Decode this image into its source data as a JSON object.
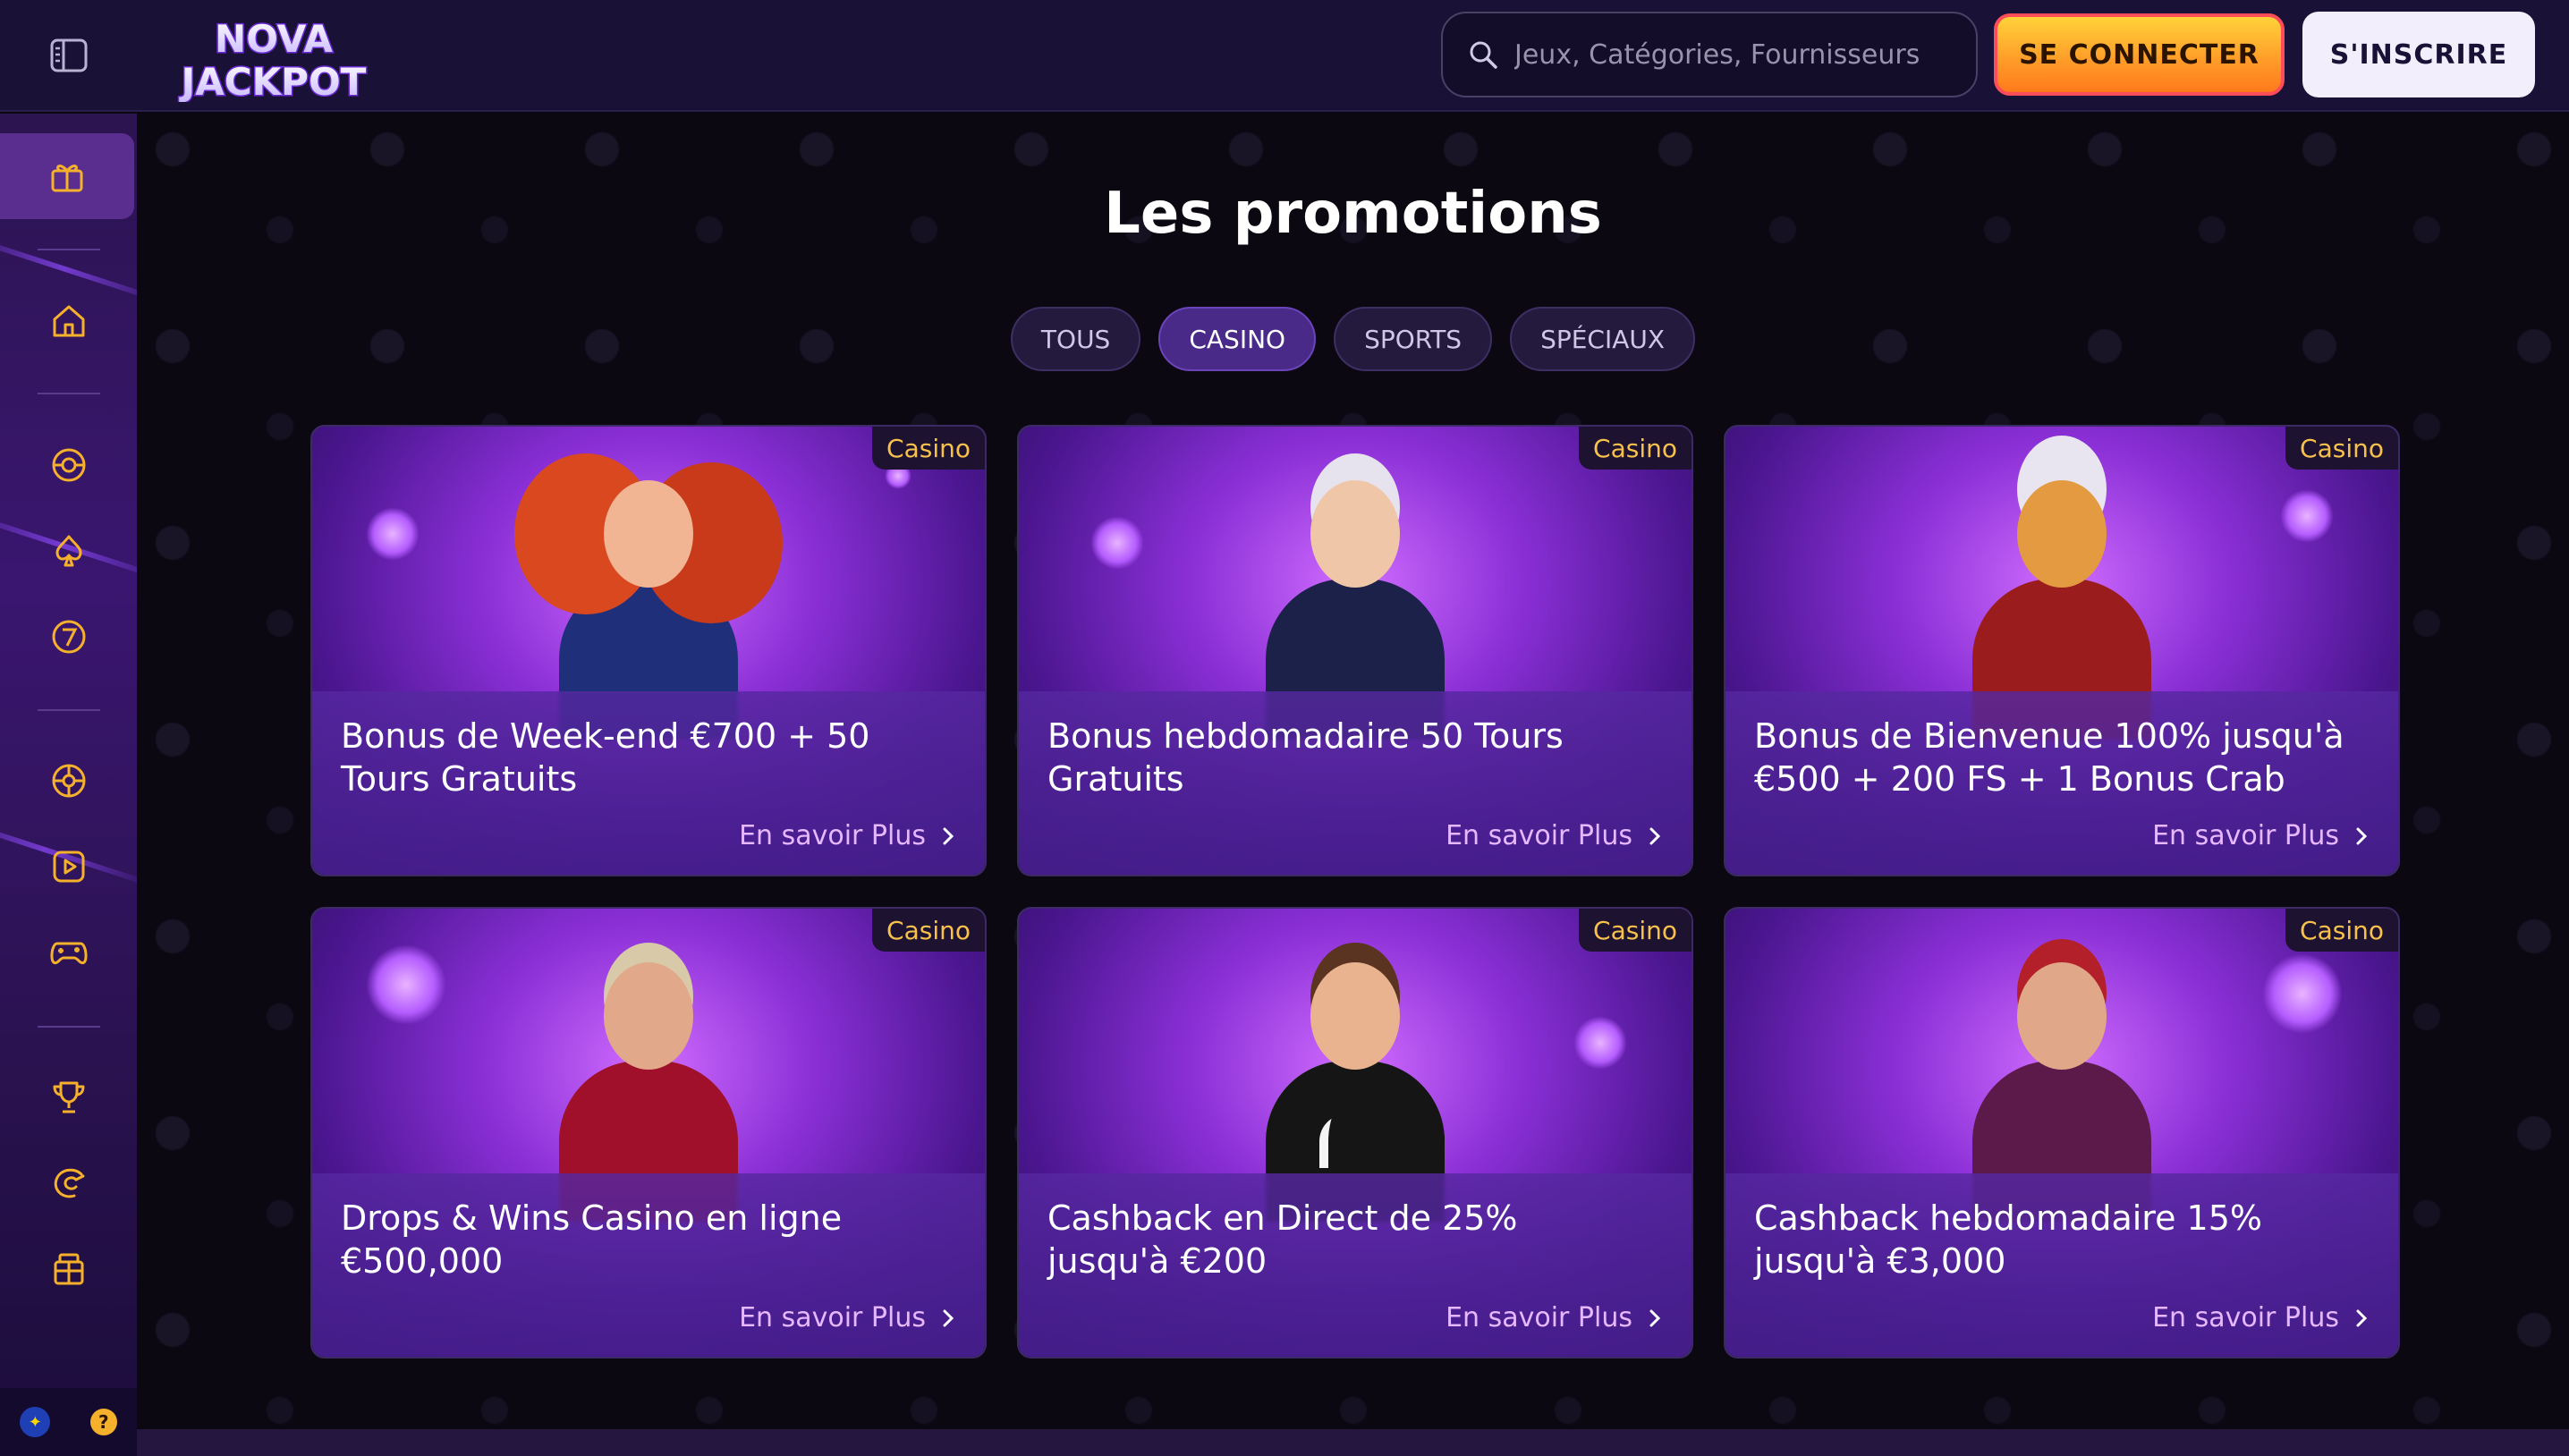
{
  "header": {
    "search_placeholder": "Jeux, Catégories, Fournisseurs",
    "login_label": "SE CONNECTER",
    "register_label": "S'INSCRIRE",
    "logo_line1": "NOVA",
    "logo_line2": "JACKPOT"
  },
  "sidebar": {
    "items": [
      {
        "icon": "promotions-icon",
        "active": true
      },
      {
        "icon": "home-icon"
      },
      {
        "icon": "sports-icon"
      },
      {
        "icon": "poker-icon"
      },
      {
        "icon": "lucky-seven-icon"
      },
      {
        "icon": "roulette-icon"
      },
      {
        "icon": "live-play-icon"
      },
      {
        "icon": "gamepad-icon"
      },
      {
        "icon": "trophy-icon"
      },
      {
        "icon": "racing-icon"
      },
      {
        "icon": "gift-icon"
      }
    ],
    "help_label": "?"
  },
  "main": {
    "title": "Les promotions",
    "tabs": [
      {
        "label": "TOUS",
        "active": false
      },
      {
        "label": "CASINO",
        "active": true
      },
      {
        "label": "SPORTS",
        "active": false
      },
      {
        "label": "SPÉCIAUX",
        "active": false
      }
    ],
    "cards": [
      {
        "badge": "Casino",
        "title": "Bonus de Week-end €700 + 50 Tours Gratuits",
        "link": "En savoir Plus"
      },
      {
        "badge": "Casino",
        "title": "Bonus hebdomadaire 50 Tours Gratuits",
        "link": "En savoir Plus"
      },
      {
        "badge": "Casino",
        "title": "Bonus de Bienvenue 100% jusqu'à €500 + 200 FS + 1 Bonus Crab",
        "link": "En savoir Plus"
      },
      {
        "badge": "Casino",
        "title": "Drops & Wins Casino en ligne €500,000",
        "link": "En savoir Plus"
      },
      {
        "badge": "Casino",
        "title": "Cashback en Direct de 25% jusqu'à €200",
        "link": "En savoir Plus"
      },
      {
        "badge": "Casino",
        "title": "Cashback hebdomadaire 15% jusqu'à €3,000",
        "link": "En savoir Plus"
      }
    ]
  },
  "colors": {
    "header_bg": "#1a1136",
    "accent_orange": "#ff9a28",
    "badge_text": "#f7c14c",
    "link_text": "#e7b8ff",
    "tab_active": "#4a2a88"
  }
}
